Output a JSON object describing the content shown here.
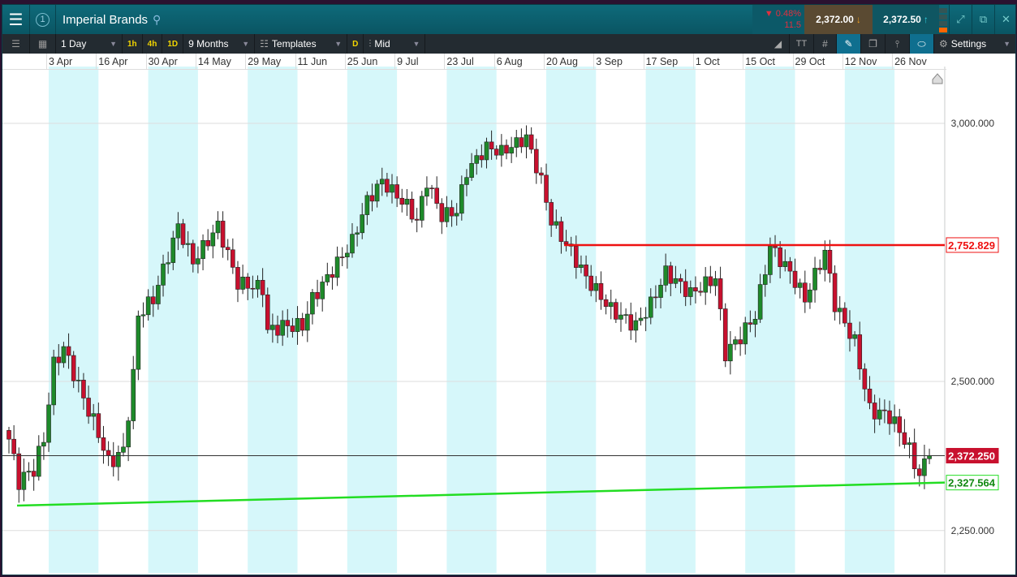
{
  "window": {
    "instrument": "Imperial Brands",
    "workspace_num": "1",
    "change_pct": "▼ 0.48%",
    "change_abs": "11.5",
    "bid": "2,372.00",
    "ask": "2,372.50"
  },
  "toolbar": {
    "interval": "1 Day",
    "quick": [
      "1h",
      "4h",
      "1D"
    ],
    "range": "9 Months",
    "templates": "Templates",
    "d": "D",
    "price_type": "Mid",
    "settings": "Settings",
    "tt": "TT"
  },
  "colors": {
    "up": "#1e8a2a",
    "down": "#c8102e",
    "band": "#d6f7fa",
    "support": "#22dd22",
    "resistance": "#ee1111"
  },
  "chart_data": {
    "type": "candlestick",
    "title": "Imperial Brands",
    "scale": "log",
    "x_ticks": [
      "3 Apr",
      "16 Apr",
      "30 Apr",
      "14 May",
      "29 May",
      "11 Jun",
      "25 Jun",
      "9 Jul",
      "23 Jul",
      "6 Aug",
      "20 Aug",
      "3 Sep",
      "17 Sep",
      "1 Oct",
      "15 Oct",
      "29 Oct",
      "12 Nov",
      "26 Nov"
    ],
    "y_ticks": [
      "3,000.000",
      "2,500.000",
      "2,250.000"
    ],
    "y_tick_values": [
      3000,
      2500,
      2250
    ],
    "ylim": [
      2200,
      3130
    ],
    "close_waypoints": [
      [
        0,
        2400
      ],
      [
        2,
        2330
      ],
      [
        5,
        2350
      ],
      [
        7,
        2400
      ],
      [
        9,
        2530
      ],
      [
        11,
        2560
      ],
      [
        15,
        2470
      ],
      [
        18,
        2410
      ],
      [
        20,
        2360
      ],
      [
        23,
        2380
      ],
      [
        25,
        2510
      ],
      [
        26,
        2620
      ],
      [
        29,
        2650
      ],
      [
        33,
        2760
      ],
      [
        34,
        2790
      ],
      [
        37,
        2720
      ],
      [
        42,
        2790
      ],
      [
        46,
        2680
      ],
      [
        51,
        2670
      ],
      [
        52,
        2590
      ],
      [
        55,
        2600
      ],
      [
        59,
        2600
      ],
      [
        61,
        2650
      ],
      [
        64,
        2690
      ],
      [
        69,
        2760
      ],
      [
        72,
        2840
      ],
      [
        75,
        2880
      ],
      [
        80,
        2830
      ],
      [
        82,
        2800
      ],
      [
        84,
        2880
      ],
      [
        87,
        2810
      ],
      [
        90,
        2820
      ],
      [
        92,
        2900
      ],
      [
        96,
        2950
      ],
      [
        99,
        2940
      ],
      [
        104,
        2970
      ],
      [
        107,
        2880
      ],
      [
        109,
        2800
      ],
      [
        113,
        2740
      ],
      [
        116,
        2690
      ],
      [
        121,
        2630
      ],
      [
        126,
        2600
      ],
      [
        129,
        2640
      ],
      [
        132,
        2700
      ],
      [
        137,
        2660
      ],
      [
        142,
        2690
      ],
      [
        144,
        2550
      ],
      [
        147,
        2580
      ],
      [
        150,
        2620
      ],
      [
        153,
        2750
      ],
      [
        157,
        2700
      ],
      [
        160,
        2650
      ],
      [
        164,
        2740
      ],
      [
        166,
        2640
      ],
      [
        170,
        2570
      ],
      [
        173,
        2450
      ],
      [
        177,
        2440
      ],
      [
        180,
        2400
      ],
      [
        183,
        2340
      ],
      [
        185,
        2372
      ]
    ],
    "current_price": 2372.25,
    "current_price_label": "2,372.250",
    "resistance": {
      "value": 2752.829,
      "label": "2,752.829"
    },
    "support": {
      "start": 2290,
      "end": 2327.564,
      "label": "2,327.564"
    }
  }
}
